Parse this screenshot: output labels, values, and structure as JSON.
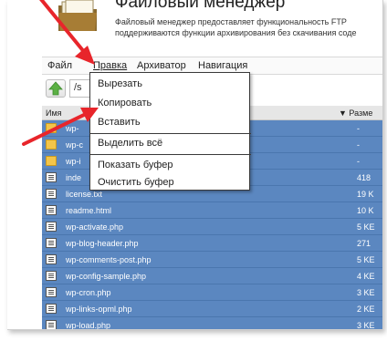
{
  "header": {
    "title": "Файловый менеджер",
    "description_line1": "Файловый менеджер предоставляет функциональность FTP",
    "description_line2": "поддерживаются функции архивирования без скачивания соде"
  },
  "menubar": {
    "items": [
      "Файл",
      "Правка",
      "Архиватор",
      "Навигация"
    ]
  },
  "toolbar": {
    "path_value": "/s"
  },
  "table": {
    "headers": {
      "name": "Имя",
      "size": "▼ Разме"
    },
    "rows": [
      {
        "name": "wp-",
        "size": "-",
        "type": "folder"
      },
      {
        "name": "wp-c",
        "size": "-",
        "type": "folder"
      },
      {
        "name": "wp-i",
        "size": "-",
        "type": "folder"
      },
      {
        "name": "inde",
        "size": "418",
        "type": "file"
      },
      {
        "name": "license.txt",
        "size": "19 K",
        "type": "file"
      },
      {
        "name": "readme.html",
        "size": "10 K",
        "type": "file"
      },
      {
        "name": "wp-activate.php",
        "size": "5 KE",
        "type": "file"
      },
      {
        "name": "wp-blog-header.php",
        "size": "271",
        "type": "file"
      },
      {
        "name": "wp-comments-post.php",
        "size": "5 KE",
        "type": "file"
      },
      {
        "name": "wp-config-sample.php",
        "size": "4 KE",
        "type": "file"
      },
      {
        "name": "wp-cron.php",
        "size": "3 KE",
        "type": "file"
      },
      {
        "name": "wp-links-opml.php",
        "size": "2 KE",
        "type": "file"
      },
      {
        "name": "wp-load.php",
        "size": "3 KE",
        "type": "file"
      }
    ]
  },
  "dropdown": {
    "items": [
      "Вырезать",
      "Копировать",
      "Вставить",
      "Выделить всё",
      "Показать буфер",
      "Очистить буфер"
    ]
  },
  "colors": {
    "row_bg": "#5b87c0",
    "arrow": "#e8252b",
    "folder": "#f3c54a"
  },
  "icons": {
    "up": "arrow-up-icon",
    "folder": "folder-icon",
    "file": "file-icon"
  }
}
